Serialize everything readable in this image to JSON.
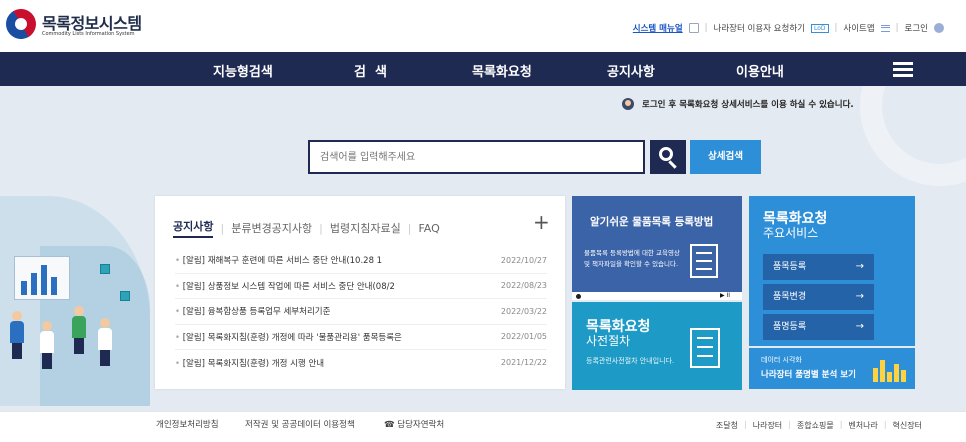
{
  "header": {
    "title": "목록정보시스템",
    "subtitle": "Commodity Lists Information System",
    "util": {
      "system_manual": "시스템 매뉴얼",
      "request": "나라장터 이용자 요청하기",
      "lod_badge": "LoD",
      "sitemap": "사이트맵",
      "login": "로그인"
    }
  },
  "nav": {
    "items": [
      "지능형검색",
      "검  색",
      "목록화요청",
      "공지사항",
      "이용안내"
    ]
  },
  "hero": {
    "login_notice": "로그인 후 목록화요청 상세서비스를 이용 하실 수 있습니다.",
    "search": {
      "placeholder": "검색어를 입력해주세요",
      "advanced_label": "상세검색"
    }
  },
  "notice_panel": {
    "tabs": [
      "공지사항",
      "분류변경공지사항",
      "법령지침자료실",
      "FAQ"
    ],
    "more": "+",
    "items": [
      {
        "title": "[알림] 재해복구 훈련에 따른 서비스 중단 안내(10.28 1",
        "date": "2022/10/27"
      },
      {
        "title": "[알림] 상품정보 시스템 작업에 따른 서비스 중단 안내(08/2",
        "date": "2022/08/23"
      },
      {
        "title": "[알림] 융복합상품 등록업무 세부처리기준",
        "date": "2022/03/22"
      },
      {
        "title": "[알림] 목록화지침(훈령) 개정에 따라 '물품관리용' 품목등록은",
        "date": "2022/01/05"
      },
      {
        "title": "[알림] 목록화지침(훈령) 개정 시행 안내",
        "date": "2021/12/22"
      }
    ]
  },
  "card_guide": {
    "title": "알기쉬운 물품목록 등록방법",
    "desc": "물품목록 등록방법에 대한 교육영상 및 책자파일을 확인할 수 있습니다.",
    "play": "▶ II"
  },
  "card_precheck": {
    "title1": "목록화요청",
    "title2": "사전절차",
    "desc": "등록관련사전절차 안내입니다."
  },
  "card_services": {
    "title1": "목록화요청",
    "title2": "주요서비스",
    "items": [
      "품목등록",
      "품목변경",
      "품명등록"
    ],
    "arrow": "→"
  },
  "card_analysis": {
    "small": "데이터 시각화",
    "title": "나라장터 품명별 분석 보기"
  },
  "footer": {
    "privacy": "개인정보처리방침",
    "copyright": "저작권 및 공공데이터 이용정책",
    "contact": "☎ 담당자연락처",
    "links": [
      "조달청",
      "나라장터",
      "종합쇼핑몰",
      "벤처나라",
      "혁신장터"
    ]
  },
  "colors": {
    "navy": "#1f2a52",
    "accent_blue": "#2e8fd9",
    "hero_bg": "#e3eaf1"
  }
}
